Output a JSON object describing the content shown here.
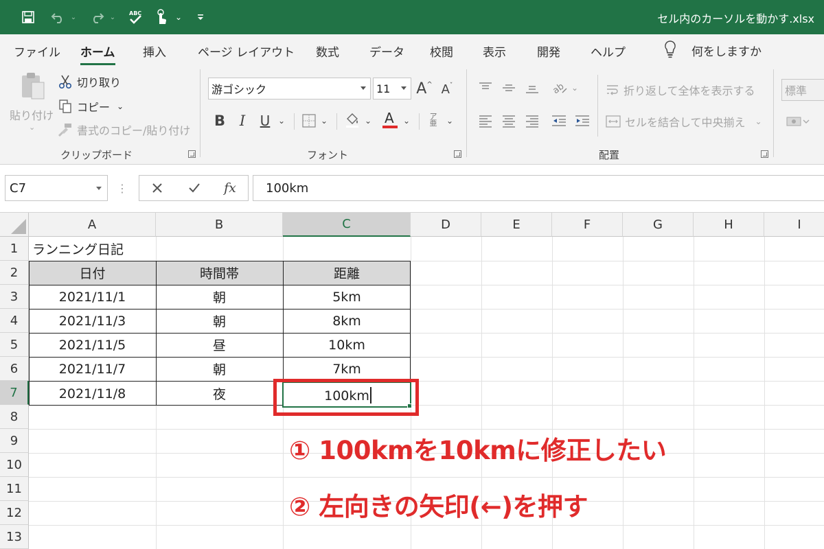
{
  "titlebar": {
    "filename": "セル内のカーソルを動かす.xlsx",
    "bg_color": "#217346"
  },
  "tabs": [
    "ファイル",
    "ホーム",
    "挿入",
    "ページ レイアウト",
    "数式",
    "データ",
    "校閲",
    "表示",
    "開発",
    "ヘルプ"
  ],
  "tell_me": "何をしますか",
  "ribbon": {
    "paste": "貼り付け",
    "cut": "切り取り",
    "copy": "コピー",
    "format_painter": "書式のコピー/貼り付け",
    "clipboard_label": "クリップボード",
    "font_name": "游ゴシック",
    "font_size": "11",
    "font_label": "フォント",
    "wrap_text": "折り返して全体を表示する",
    "merge_center": "セルを結合して中央揃え",
    "alignment_label": "配置",
    "number_format": "標準"
  },
  "formula_bar": {
    "name_box": "C7",
    "value": "100km"
  },
  "columns": [
    "A",
    "B",
    "C",
    "D",
    "E",
    "F",
    "G",
    "H",
    "I"
  ],
  "rows": [
    "1",
    "2",
    "3",
    "4",
    "5",
    "6",
    "7",
    "8",
    "9",
    "10",
    "11",
    "12",
    "13"
  ],
  "sheet": {
    "title": "ランニング日記",
    "headers": [
      "日付",
      "時間帯",
      "距離"
    ],
    "data": [
      [
        "2021/11/1",
        "朝",
        "5km"
      ],
      [
        "2021/11/3",
        "朝",
        "8km"
      ],
      [
        "2021/11/5",
        "昼",
        "10km"
      ],
      [
        "2021/11/7",
        "朝",
        "7km"
      ],
      [
        "2021/11/8",
        "夜",
        "100km"
      ]
    ]
  },
  "annotations": {
    "step1": "① 100kmを10kmに修正したい",
    "step2": "② 左向きの矢印(←)を押す",
    "color": "#e02b2b"
  }
}
